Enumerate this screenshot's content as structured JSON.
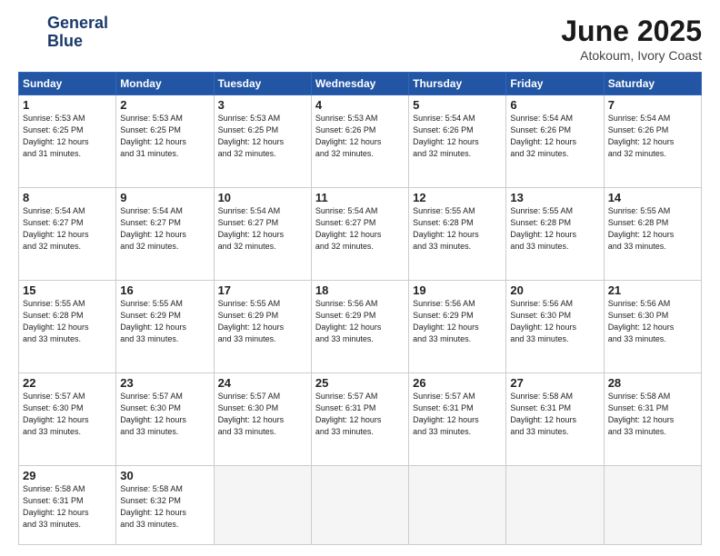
{
  "logo": {
    "line1": "General",
    "line2": "Blue"
  },
  "title": "June 2025",
  "subtitle": "Atokoum, Ivory Coast",
  "days_header": [
    "Sunday",
    "Monday",
    "Tuesday",
    "Wednesday",
    "Thursday",
    "Friday",
    "Saturday"
  ],
  "weeks": [
    [
      {
        "num": "1",
        "info": "Sunrise: 5:53 AM\nSunset: 6:25 PM\nDaylight: 12 hours\nand 31 minutes."
      },
      {
        "num": "2",
        "info": "Sunrise: 5:53 AM\nSunset: 6:25 PM\nDaylight: 12 hours\nand 31 minutes."
      },
      {
        "num": "3",
        "info": "Sunrise: 5:53 AM\nSunset: 6:25 PM\nDaylight: 12 hours\nand 32 minutes."
      },
      {
        "num": "4",
        "info": "Sunrise: 5:53 AM\nSunset: 6:26 PM\nDaylight: 12 hours\nand 32 minutes."
      },
      {
        "num": "5",
        "info": "Sunrise: 5:54 AM\nSunset: 6:26 PM\nDaylight: 12 hours\nand 32 minutes."
      },
      {
        "num": "6",
        "info": "Sunrise: 5:54 AM\nSunset: 6:26 PM\nDaylight: 12 hours\nand 32 minutes."
      },
      {
        "num": "7",
        "info": "Sunrise: 5:54 AM\nSunset: 6:26 PM\nDaylight: 12 hours\nand 32 minutes."
      }
    ],
    [
      {
        "num": "8",
        "info": "Sunrise: 5:54 AM\nSunset: 6:27 PM\nDaylight: 12 hours\nand 32 minutes."
      },
      {
        "num": "9",
        "info": "Sunrise: 5:54 AM\nSunset: 6:27 PM\nDaylight: 12 hours\nand 32 minutes."
      },
      {
        "num": "10",
        "info": "Sunrise: 5:54 AM\nSunset: 6:27 PM\nDaylight: 12 hours\nand 32 minutes."
      },
      {
        "num": "11",
        "info": "Sunrise: 5:54 AM\nSunset: 6:27 PM\nDaylight: 12 hours\nand 32 minutes."
      },
      {
        "num": "12",
        "info": "Sunrise: 5:55 AM\nSunset: 6:28 PM\nDaylight: 12 hours\nand 33 minutes."
      },
      {
        "num": "13",
        "info": "Sunrise: 5:55 AM\nSunset: 6:28 PM\nDaylight: 12 hours\nand 33 minutes."
      },
      {
        "num": "14",
        "info": "Sunrise: 5:55 AM\nSunset: 6:28 PM\nDaylight: 12 hours\nand 33 minutes."
      }
    ],
    [
      {
        "num": "15",
        "info": "Sunrise: 5:55 AM\nSunset: 6:28 PM\nDaylight: 12 hours\nand 33 minutes."
      },
      {
        "num": "16",
        "info": "Sunrise: 5:55 AM\nSunset: 6:29 PM\nDaylight: 12 hours\nand 33 minutes."
      },
      {
        "num": "17",
        "info": "Sunrise: 5:55 AM\nSunset: 6:29 PM\nDaylight: 12 hours\nand 33 minutes."
      },
      {
        "num": "18",
        "info": "Sunrise: 5:56 AM\nSunset: 6:29 PM\nDaylight: 12 hours\nand 33 minutes."
      },
      {
        "num": "19",
        "info": "Sunrise: 5:56 AM\nSunset: 6:29 PM\nDaylight: 12 hours\nand 33 minutes."
      },
      {
        "num": "20",
        "info": "Sunrise: 5:56 AM\nSunset: 6:30 PM\nDaylight: 12 hours\nand 33 minutes."
      },
      {
        "num": "21",
        "info": "Sunrise: 5:56 AM\nSunset: 6:30 PM\nDaylight: 12 hours\nand 33 minutes."
      }
    ],
    [
      {
        "num": "22",
        "info": "Sunrise: 5:57 AM\nSunset: 6:30 PM\nDaylight: 12 hours\nand 33 minutes."
      },
      {
        "num": "23",
        "info": "Sunrise: 5:57 AM\nSunset: 6:30 PM\nDaylight: 12 hours\nand 33 minutes."
      },
      {
        "num": "24",
        "info": "Sunrise: 5:57 AM\nSunset: 6:30 PM\nDaylight: 12 hours\nand 33 minutes."
      },
      {
        "num": "25",
        "info": "Sunrise: 5:57 AM\nSunset: 6:31 PM\nDaylight: 12 hours\nand 33 minutes."
      },
      {
        "num": "26",
        "info": "Sunrise: 5:57 AM\nSunset: 6:31 PM\nDaylight: 12 hours\nand 33 minutes."
      },
      {
        "num": "27",
        "info": "Sunrise: 5:58 AM\nSunset: 6:31 PM\nDaylight: 12 hours\nand 33 minutes."
      },
      {
        "num": "28",
        "info": "Sunrise: 5:58 AM\nSunset: 6:31 PM\nDaylight: 12 hours\nand 33 minutes."
      }
    ],
    [
      {
        "num": "29",
        "info": "Sunrise: 5:58 AM\nSunset: 6:31 PM\nDaylight: 12 hours\nand 33 minutes."
      },
      {
        "num": "30",
        "info": "Sunrise: 5:58 AM\nSunset: 6:32 PM\nDaylight: 12 hours\nand 33 minutes."
      },
      {
        "num": "",
        "info": ""
      },
      {
        "num": "",
        "info": ""
      },
      {
        "num": "",
        "info": ""
      },
      {
        "num": "",
        "info": ""
      },
      {
        "num": "",
        "info": ""
      }
    ]
  ]
}
